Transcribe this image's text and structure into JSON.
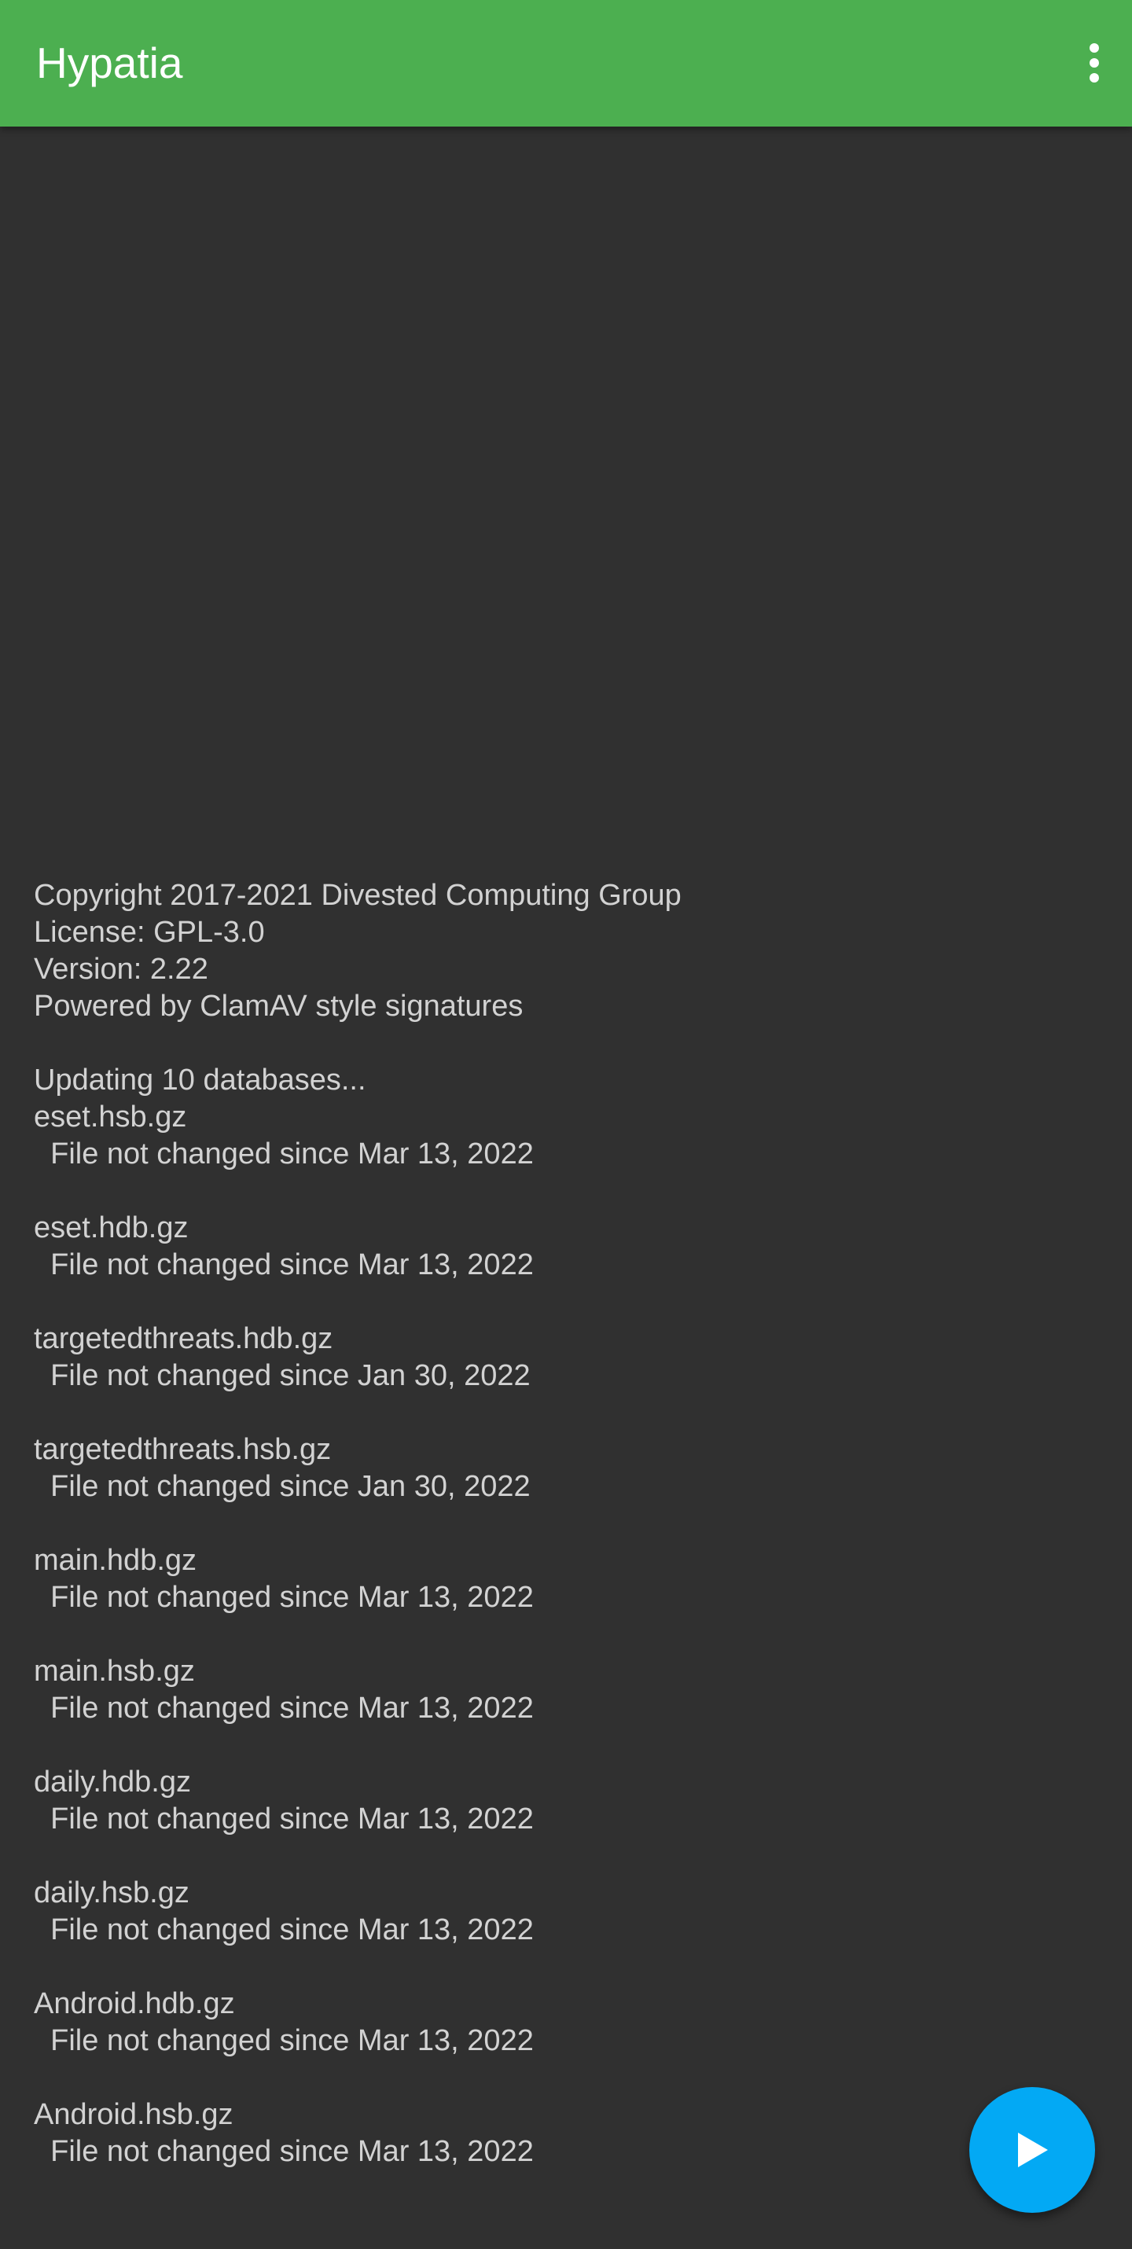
{
  "app_bar": {
    "title": "Hypatia",
    "color": "#4caf50",
    "menu_icon": "more-vert-icon"
  },
  "log": {
    "header": [
      "Copyright 2017-2021 Divested Computing Group",
      "License: GPL-3.0",
      "Version: 2.22",
      "Powered by ClamAV style signatures"
    ],
    "status": "Updating 10 databases...",
    "databases": [
      {
        "name": "eset.hsb.gz",
        "detail": "  File not changed since Mar 13, 2022"
      },
      {
        "name": "eset.hdb.gz",
        "detail": "  File not changed since Mar 13, 2022"
      },
      {
        "name": "targetedthreats.hdb.gz",
        "detail": "  File not changed since Jan 30, 2022"
      },
      {
        "name": "targetedthreats.hsb.gz",
        "detail": "  File not changed since Jan 30, 2022"
      },
      {
        "name": "main.hdb.gz",
        "detail": "  File not changed since Mar 13, 2022"
      },
      {
        "name": "main.hsb.gz",
        "detail": "  File not changed since Mar 13, 2022"
      },
      {
        "name": "daily.hdb.gz",
        "detail": "  File not changed since Mar 13, 2022"
      },
      {
        "name": "daily.hsb.gz",
        "detail": "  File not changed since Mar 13, 2022"
      },
      {
        "name": "Android.hdb.gz",
        "detail": "  File not changed since Mar 13, 2022"
      },
      {
        "name": "Android.hsb.gz",
        "detail": "  File not changed since Mar 13, 2022"
      }
    ]
  },
  "fab": {
    "icon": "play-icon",
    "color": "#03a9f4"
  }
}
